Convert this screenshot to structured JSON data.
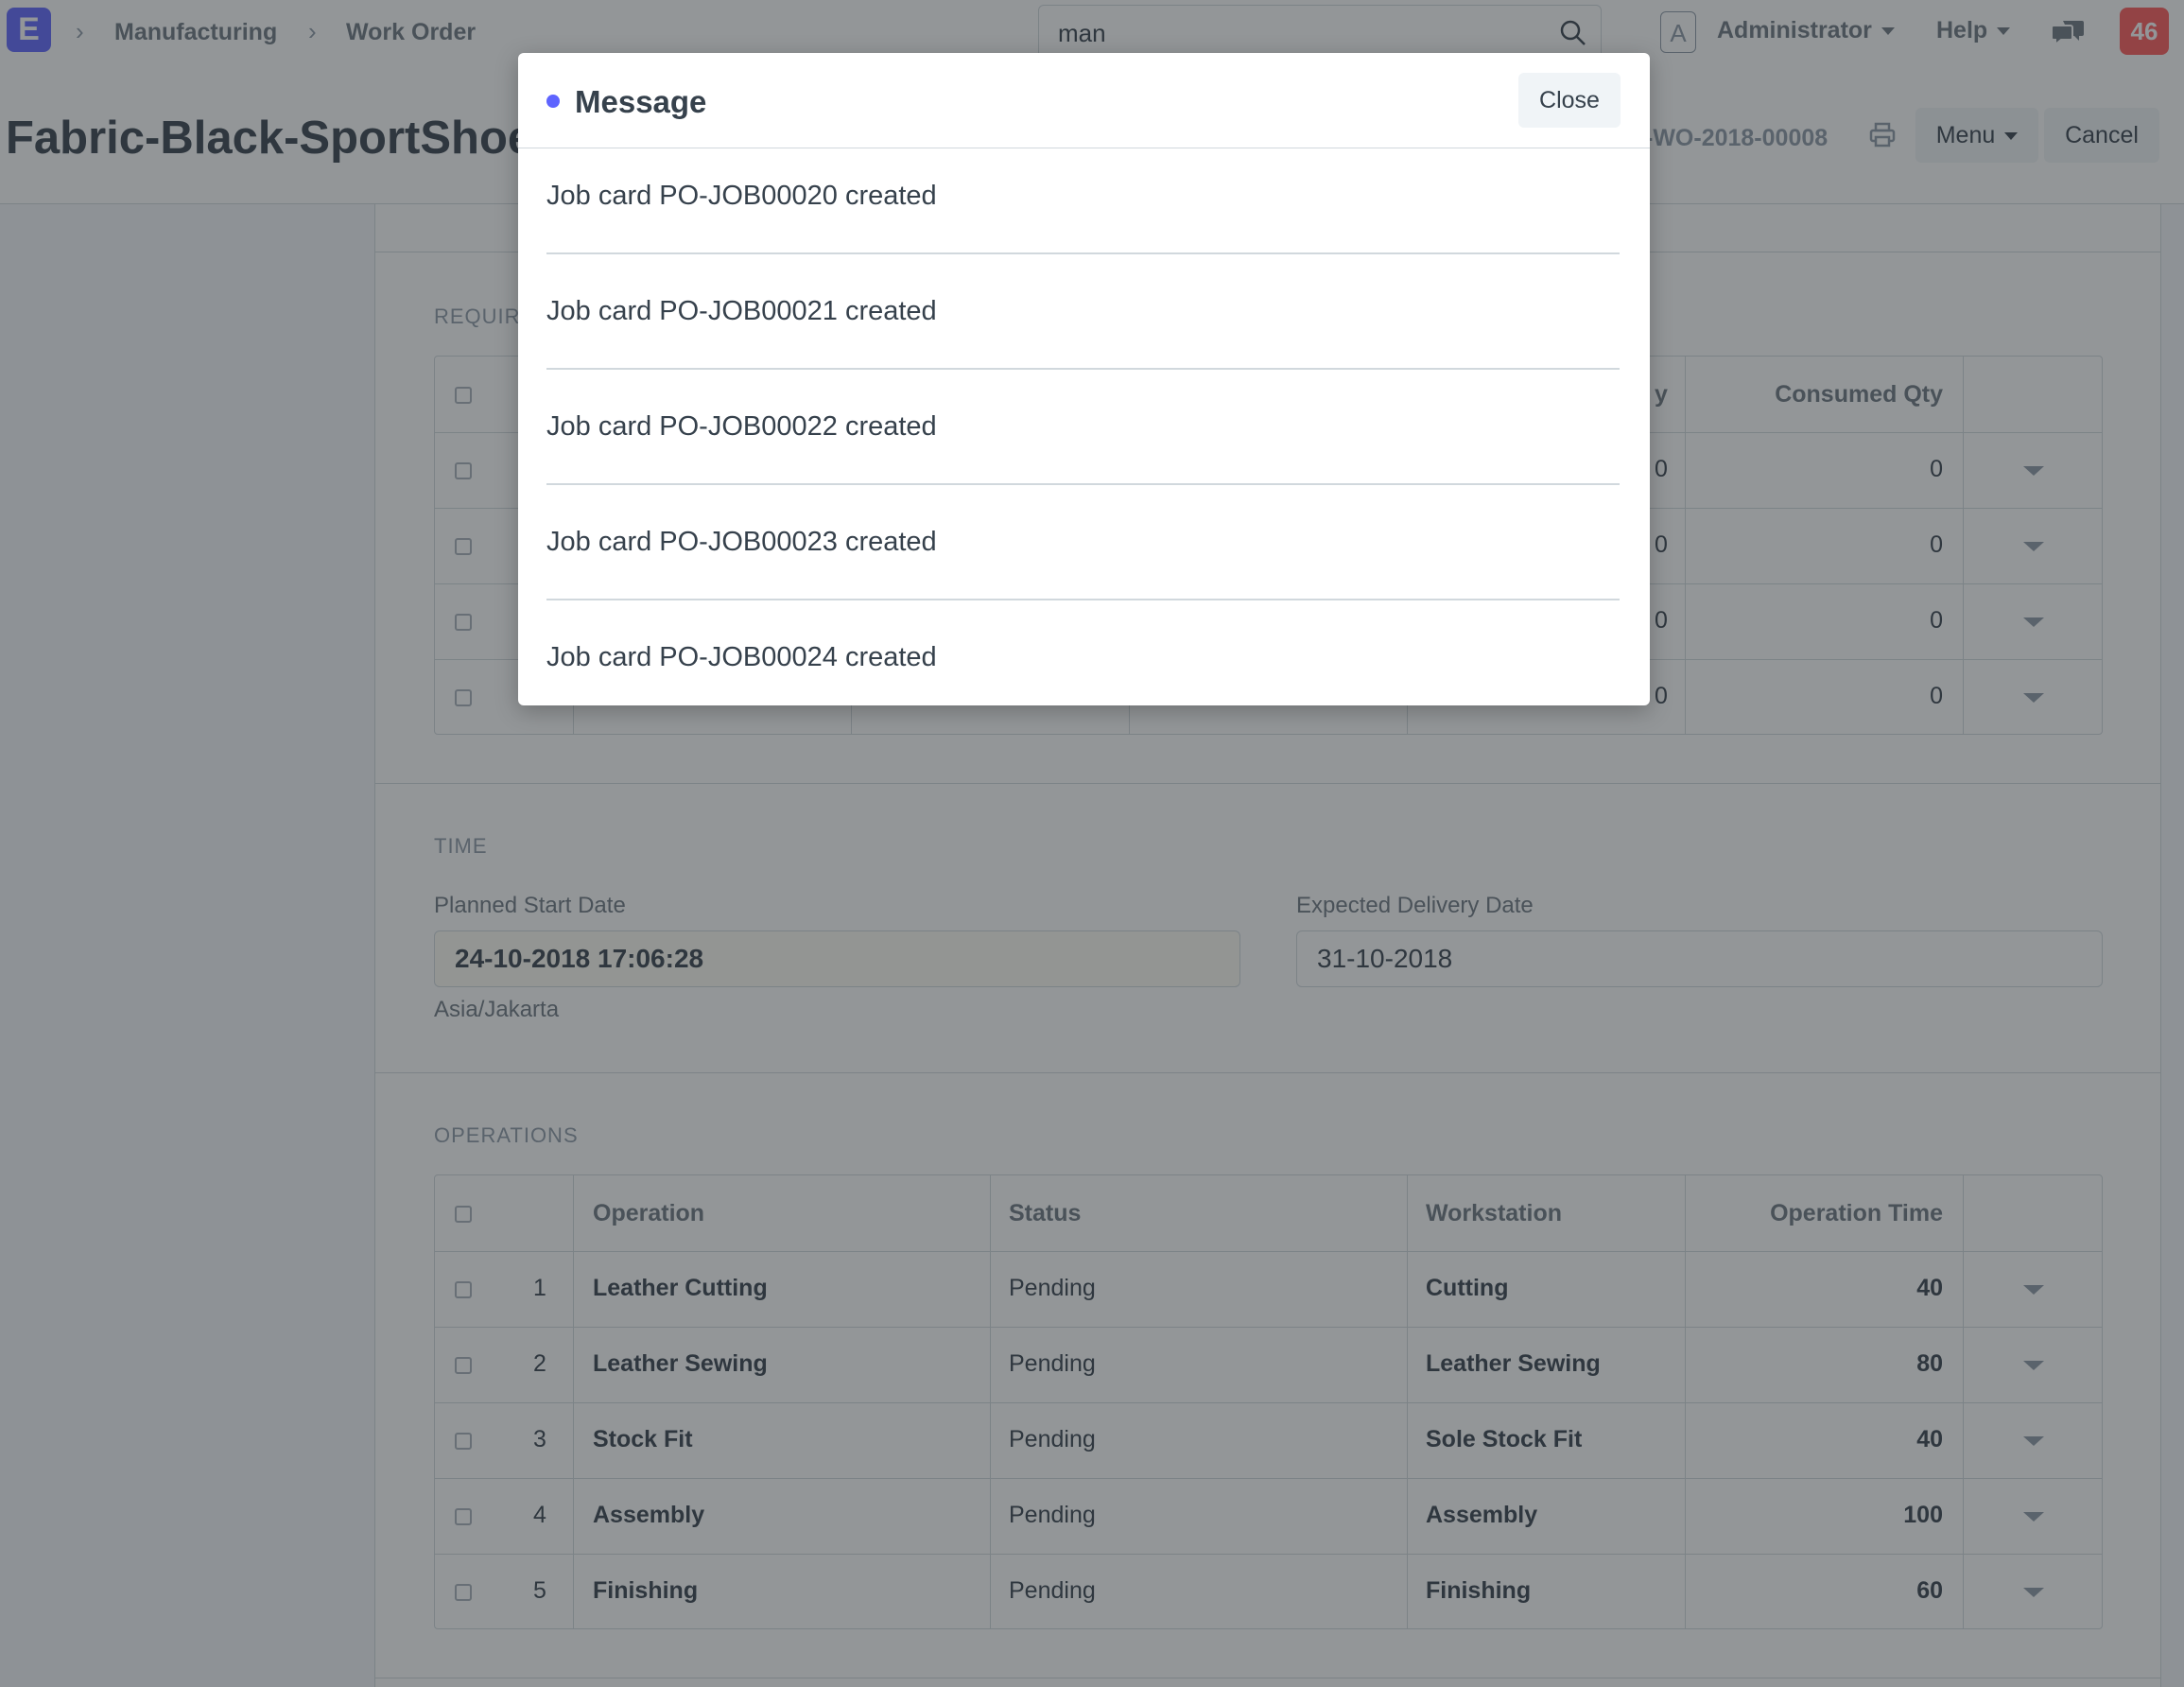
{
  "navbar": {
    "logo": "E",
    "breadcrumbs": [
      "Manufacturing",
      "Work Order"
    ],
    "search_value": "man",
    "avatar_letter": "A",
    "user_menu": "Administrator",
    "help_menu": "Help",
    "notification_count": "46"
  },
  "page": {
    "title": "Fabric-Black-SportShoes",
    "doc_name": "-WO-2018-00008",
    "menu_button": "Menu",
    "cancel_button": "Cancel"
  },
  "required_items": {
    "section_label": "REQUIR",
    "header_partial": "y",
    "consumed_header": "Consumed Qty",
    "rows": [
      {
        "partial": "0",
        "consumed": "0"
      },
      {
        "partial": "0",
        "consumed": "0"
      },
      {
        "partial": "0",
        "consumed": "0"
      },
      {
        "partial": "0",
        "consumed": "0"
      }
    ]
  },
  "time": {
    "section_label": "TIME",
    "planned_start_label": "Planned Start Date",
    "planned_start_value": "24-10-2018 17:06:28",
    "timezone": "Asia/Jakarta",
    "expected_delivery_label": "Expected Delivery Date",
    "expected_delivery_value": "31-10-2018"
  },
  "operations": {
    "section_label": "OPERATIONS",
    "headers": {
      "operation": "Operation",
      "status": "Status",
      "workstation": "Workstation",
      "time": "Operation Time"
    },
    "rows": [
      {
        "idx": "1",
        "operation": "Leather Cutting",
        "status": "Pending",
        "workstation": "Cutting",
        "time": "40"
      },
      {
        "idx": "2",
        "operation": "Leather Sewing",
        "status": "Pending",
        "workstation": "Leather Sewing",
        "time": "80"
      },
      {
        "idx": "3",
        "operation": "Stock Fit",
        "status": "Pending",
        "workstation": "Sole Stock Fit",
        "time": "40"
      },
      {
        "idx": "4",
        "operation": "Assembly",
        "status": "Pending",
        "workstation": "Assembly",
        "time": "100"
      },
      {
        "idx": "5",
        "operation": "Finishing",
        "status": "Pending",
        "workstation": "Finishing",
        "time": "60"
      }
    ]
  },
  "modal": {
    "title": "Message",
    "close_button": "Close",
    "messages": [
      "Job card PO-JOB00020 created",
      "Job card PO-JOB00021 created",
      "Job card PO-JOB00022 created",
      "Job card PO-JOB00023 created",
      "Job card PO-JOB00024 created"
    ]
  },
  "colors": {
    "accent": "#5e64ff",
    "notification": "#ff5858",
    "planned_start_bg": "#fffdf4"
  }
}
